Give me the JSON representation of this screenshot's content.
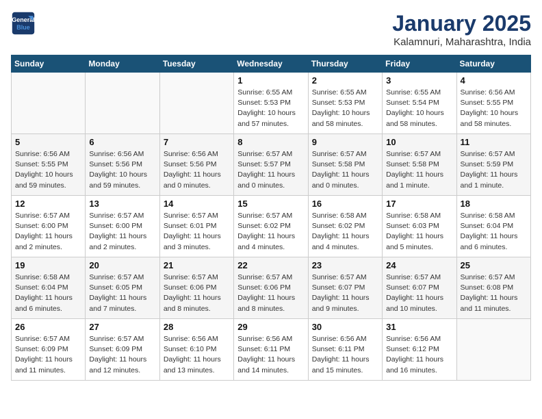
{
  "logo": {
    "line1": "General",
    "line2": "Blue"
  },
  "title": "January 2025",
  "subtitle": "Kalamnuri, Maharashtra, India",
  "weekdays": [
    "Sunday",
    "Monday",
    "Tuesday",
    "Wednesday",
    "Thursday",
    "Friday",
    "Saturday"
  ],
  "weeks": [
    [
      {
        "num": "",
        "info": ""
      },
      {
        "num": "",
        "info": ""
      },
      {
        "num": "",
        "info": ""
      },
      {
        "num": "1",
        "info": "Sunrise: 6:55 AM\nSunset: 5:53 PM\nDaylight: 10 hours\nand 57 minutes."
      },
      {
        "num": "2",
        "info": "Sunrise: 6:55 AM\nSunset: 5:53 PM\nDaylight: 10 hours\nand 58 minutes."
      },
      {
        "num": "3",
        "info": "Sunrise: 6:55 AM\nSunset: 5:54 PM\nDaylight: 10 hours\nand 58 minutes."
      },
      {
        "num": "4",
        "info": "Sunrise: 6:56 AM\nSunset: 5:55 PM\nDaylight: 10 hours\nand 58 minutes."
      }
    ],
    [
      {
        "num": "5",
        "info": "Sunrise: 6:56 AM\nSunset: 5:55 PM\nDaylight: 10 hours\nand 59 minutes."
      },
      {
        "num": "6",
        "info": "Sunrise: 6:56 AM\nSunset: 5:56 PM\nDaylight: 10 hours\nand 59 minutes."
      },
      {
        "num": "7",
        "info": "Sunrise: 6:56 AM\nSunset: 5:56 PM\nDaylight: 11 hours\nand 0 minutes."
      },
      {
        "num": "8",
        "info": "Sunrise: 6:57 AM\nSunset: 5:57 PM\nDaylight: 11 hours\nand 0 minutes."
      },
      {
        "num": "9",
        "info": "Sunrise: 6:57 AM\nSunset: 5:58 PM\nDaylight: 11 hours\nand 0 minutes."
      },
      {
        "num": "10",
        "info": "Sunrise: 6:57 AM\nSunset: 5:58 PM\nDaylight: 11 hours\nand 1 minute."
      },
      {
        "num": "11",
        "info": "Sunrise: 6:57 AM\nSunset: 5:59 PM\nDaylight: 11 hours\nand 1 minute."
      }
    ],
    [
      {
        "num": "12",
        "info": "Sunrise: 6:57 AM\nSunset: 6:00 PM\nDaylight: 11 hours\nand 2 minutes."
      },
      {
        "num": "13",
        "info": "Sunrise: 6:57 AM\nSunset: 6:00 PM\nDaylight: 11 hours\nand 2 minutes."
      },
      {
        "num": "14",
        "info": "Sunrise: 6:57 AM\nSunset: 6:01 PM\nDaylight: 11 hours\nand 3 minutes."
      },
      {
        "num": "15",
        "info": "Sunrise: 6:57 AM\nSunset: 6:02 PM\nDaylight: 11 hours\nand 4 minutes."
      },
      {
        "num": "16",
        "info": "Sunrise: 6:58 AM\nSunset: 6:02 PM\nDaylight: 11 hours\nand 4 minutes."
      },
      {
        "num": "17",
        "info": "Sunrise: 6:58 AM\nSunset: 6:03 PM\nDaylight: 11 hours\nand 5 minutes."
      },
      {
        "num": "18",
        "info": "Sunrise: 6:58 AM\nSunset: 6:04 PM\nDaylight: 11 hours\nand 6 minutes."
      }
    ],
    [
      {
        "num": "19",
        "info": "Sunrise: 6:58 AM\nSunset: 6:04 PM\nDaylight: 11 hours\nand 6 minutes."
      },
      {
        "num": "20",
        "info": "Sunrise: 6:57 AM\nSunset: 6:05 PM\nDaylight: 11 hours\nand 7 minutes."
      },
      {
        "num": "21",
        "info": "Sunrise: 6:57 AM\nSunset: 6:06 PM\nDaylight: 11 hours\nand 8 minutes."
      },
      {
        "num": "22",
        "info": "Sunrise: 6:57 AM\nSunset: 6:06 PM\nDaylight: 11 hours\nand 8 minutes."
      },
      {
        "num": "23",
        "info": "Sunrise: 6:57 AM\nSunset: 6:07 PM\nDaylight: 11 hours\nand 9 minutes."
      },
      {
        "num": "24",
        "info": "Sunrise: 6:57 AM\nSunset: 6:07 PM\nDaylight: 11 hours\nand 10 minutes."
      },
      {
        "num": "25",
        "info": "Sunrise: 6:57 AM\nSunset: 6:08 PM\nDaylight: 11 hours\nand 11 minutes."
      }
    ],
    [
      {
        "num": "26",
        "info": "Sunrise: 6:57 AM\nSunset: 6:09 PM\nDaylight: 11 hours\nand 11 minutes."
      },
      {
        "num": "27",
        "info": "Sunrise: 6:57 AM\nSunset: 6:09 PM\nDaylight: 11 hours\nand 12 minutes."
      },
      {
        "num": "28",
        "info": "Sunrise: 6:56 AM\nSunset: 6:10 PM\nDaylight: 11 hours\nand 13 minutes."
      },
      {
        "num": "29",
        "info": "Sunrise: 6:56 AM\nSunset: 6:11 PM\nDaylight: 11 hours\nand 14 minutes."
      },
      {
        "num": "30",
        "info": "Sunrise: 6:56 AM\nSunset: 6:11 PM\nDaylight: 11 hours\nand 15 minutes."
      },
      {
        "num": "31",
        "info": "Sunrise: 6:56 AM\nSunset: 6:12 PM\nDaylight: 11 hours\nand 16 minutes."
      },
      {
        "num": "",
        "info": ""
      }
    ]
  ]
}
